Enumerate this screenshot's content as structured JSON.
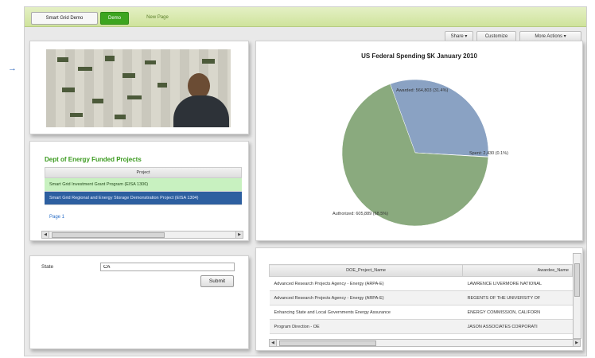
{
  "header": {
    "tabs": [
      {
        "label": "Smart Grid Demo"
      },
      {
        "label": "Demo"
      },
      {
        "label": "New Page"
      }
    ]
  },
  "actions": {
    "share": "Share ▾",
    "customize": "Customize",
    "more": "More Actions ▾"
  },
  "doe_panel": {
    "title": "Dept of Energy Funded Projects",
    "column": "Project",
    "rows": [
      "Smart Grid Investment Grant Program (EISA 1306)",
      "Smart Grid Regional and Energy Storage Demonstration Project (EISA 1304)"
    ],
    "pager": "Page 1"
  },
  "chart_data": {
    "type": "pie",
    "title": "US Federal Spending $K January 2010",
    "slices": [
      {
        "label": "Awarded",
        "value_text": "Awarded: 564,803 (31.4%)",
        "percent": 31.4
      },
      {
        "label": "Spent",
        "value_text": "Spent: 2,430 (0.1%)",
        "percent": 0.1
      },
      {
        "label": "Authorized",
        "value_text": "Authorized: 605,889 (68.5%)",
        "percent": 68.5
      }
    ],
    "colors": [
      "#8aa2c3",
      "#8aa2c3",
      "#8aaa7e"
    ]
  },
  "form": {
    "state_label": "State",
    "state_value": "CA",
    "submit_label": "Submit"
  },
  "table": {
    "columns": [
      "DOE_Project_Name",
      "Awardee_Name"
    ],
    "rows": [
      [
        "Advanced Research Projects Agency - Energy (ARPA-E)",
        "LAWRENCE LIVERMORE NATIONAL"
      ],
      [
        "Advanced Research Projects Agency - Energy (ARPA-E)",
        "REGENTS OF THE UNIVERSITY OF"
      ],
      [
        "Enhancing State and Local Governments Energy Assurance",
        "ENERGY COMMISSION, CALIFORN"
      ],
      [
        "Program Direction - OE",
        "JASON ASSOCIATES CORPORATI"
      ]
    ]
  }
}
